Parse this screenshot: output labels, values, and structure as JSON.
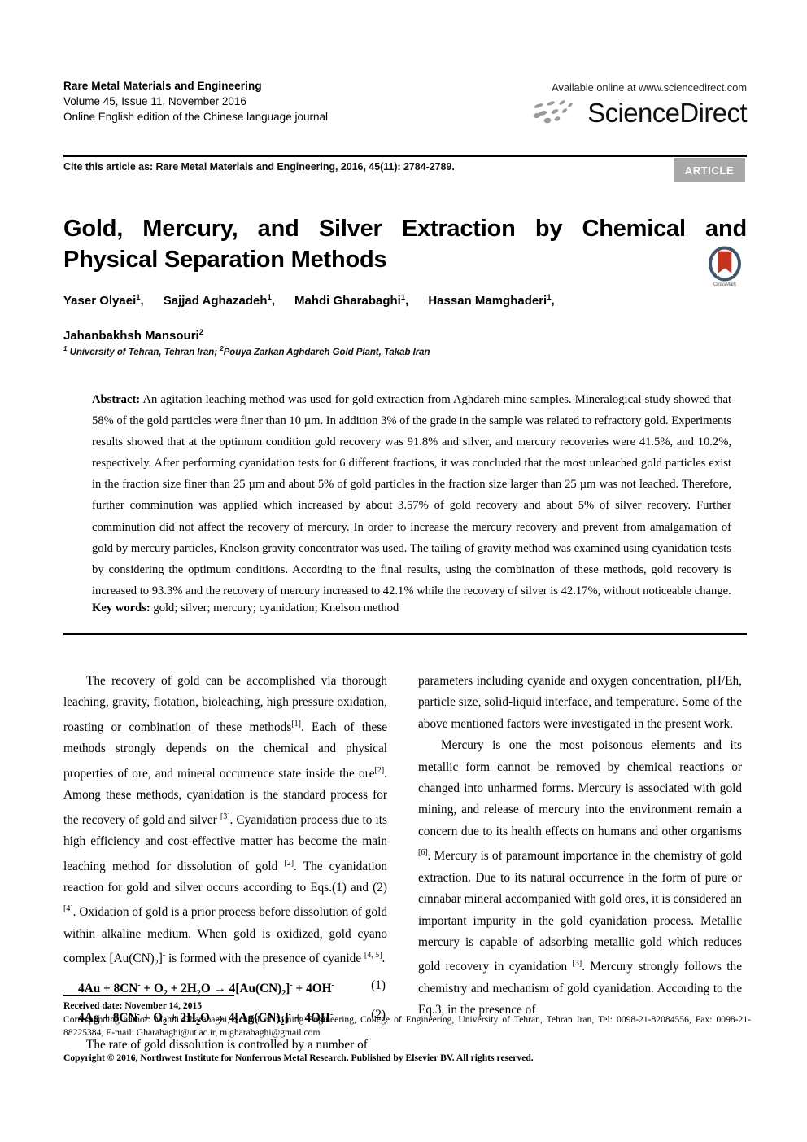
{
  "masthead": {
    "journal_name": "Rare Metal Materials and Engineering",
    "volume_line": "Volume 45, Issue 11, November 2016",
    "edition_line": "Online English edition of the Chinese language journal",
    "available_online": "Available online at www.sciencedirect.com",
    "sciencedirect_wordmark": "ScienceDirect"
  },
  "cite": {
    "text": "Cite this article as: Rare Metal Materials and Engineering, 2016, 45(11): 2784-2789.",
    "badge": "ARTICLE",
    "badge_color": "#a8a8a8"
  },
  "article": {
    "title_line1": "Gold, Mercury, and Silver Extraction by Chemical and",
    "title_line2": "Physical Separation Methods",
    "crossmark_label": "CrossMark",
    "crossmark_colors": {
      "ring": "#41566b",
      "ribbon": "#c8331f",
      "plate": "#ffffff"
    },
    "authors": [
      {
        "name": "Yaser Olyaei",
        "affil": "1"
      },
      {
        "name": "Sajjad Aghazadeh",
        "affil": "1"
      },
      {
        "name": "Mahdi Gharabaghi",
        "affil": "1"
      },
      {
        "name": "Hassan Mamghaderi",
        "affil": "1"
      },
      {
        "name": "Jahanbakhsh Mansouri",
        "affil": "2"
      }
    ],
    "affiliation_1_marker": "1",
    "affiliation_1": "University of Tehran, Tehran Iran;",
    "affiliation_2_marker": "2",
    "affiliation_2": "Pouya Zarkan Aghdareh Gold Plant, Takab Iran"
  },
  "abstract": {
    "label": "Abstract:",
    "body": "An agitation leaching method was used for gold extraction from Aghdareh mine samples. Mineralogical study showed that 58% of the gold particles were finer than 10 µm. In addition 3% of the grade in the sample was related to refractory gold. Experiments results showed that at the optimum condition gold recovery was 91.8% and silver, and mercury recoveries were 41.5%, and 10.2%, respectively. After performing cyanidation tests for 6 different fractions, it was concluded that the most unleached gold particles exist in the fraction size finer than 25 µm and about 5% of gold particles in the fraction size larger than 25 µm was not leached. Therefore, further comminution was applied which increased by about 3.57% of gold recovery and about 5% of silver recovery. Further comminution did not affect the recovery of mercury. In order to increase the mercury recovery and prevent from amalgamation of gold by mercury particles, Knelson gravity concentrator was used. The tailing of gravity method was examined using cyanidation tests by considering the optimum conditions. According to the final results, using the combination of these methods, gold recovery is increased to 93.3% and the recovery of mercury increased to 42.1% while the recovery of silver is 42.17%, without noticeable change.",
    "keywords_label": "Key words:",
    "keywords": "gold; silver; mercury; cyanidation; Knelson method"
  },
  "body": {
    "left": {
      "para1_a": "The recovery of gold can be accomplished via thorough leaching, gravity, flotation, bioleaching, high pressure oxidation, roasting or combination of these methods",
      "ref1": "[1]",
      "para1_b": ". Each of these methods strongly depends on the chemical and physical properties of ore, and mineral occurrence state inside the ore",
      "ref2": "[2]",
      "para1_c": ". Among these methods, cyanidation is the standard process for the recovery of gold and silver ",
      "ref3": "[3]",
      "para1_d": ". Cyanidation process due to its high efficiency and cost-effective matter has become the main leaching method for dissolution of gold ",
      "ref4": "[2]",
      "para1_e": ". The cyanidation reaction for gold and silver occurs according to Eqs.(1) and (2) ",
      "ref5": "[4]",
      "para1_f": ". Oxidation of gold is a prior process before dissolution of gold within alkaline medium. When gold is oxidized, gold cyano complex [Au(CN)",
      "para1_g": "]",
      "para1_h": " is formed with the presence of cyanide ",
      "ref6": "[4, 5]",
      "para1_i": ".",
      "eq1_number": "(1)",
      "eq2_number": "(2)",
      "para2": "The rate of gold dissolution is controlled by a number of"
    },
    "right": {
      "para1": "parameters including cyanide and oxygen concentration, pH/Eh, particle size, solid-liquid interface, and temperature. Some of the above mentioned factors were investigated in the present work.",
      "para2_a": "Mercury is one the most poisonous elements and its metallic form cannot be removed by chemical reactions or changed into unharmed forms. Mercury is associated with gold mining, and release of mercury into the environment remain a concern due to its health effects on humans and other organisms ",
      "ref6": "[6]",
      "para2_b": ". Mercury is of paramount importance in the chemistry of gold extraction. Due to its natural occurrence in the form of pure or cinnabar mineral accompanied with gold ores, it is considered an important impurity in the gold cyanidation process. Metallic mercury is capable of adsorbing metallic gold which reduces gold recovery in cyanidation ",
      "ref3": "[3]",
      "para2_c": ". Mercury strongly follows the chemistry and mechanism of gold cyanidation. According to the Eq.3, in the presence of"
    }
  },
  "footer": {
    "received": "Received date: November 14, 2015",
    "corresponding": "Corresponding author: Mahdi Gharabaghi, School of Mining Engineering, College of Engineering, University of Tehran, Tehran Iran, Tel: 0098-21-82084556, Fax: 0098-21-88225384, E-mail: Gharabaghi@ut.ac.ir, m.gharabaghi@gmail.com",
    "copyright": "Copyright © 2016, Northwest Institute for Nonferrous Metal Research. Published by Elsevier BV. All rights reserved."
  }
}
